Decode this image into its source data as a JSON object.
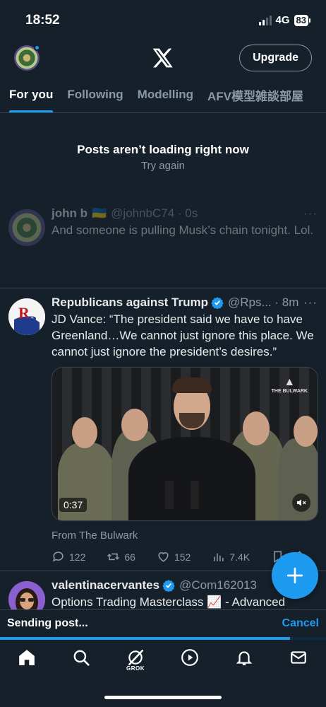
{
  "status_bar": {
    "time": "18:52",
    "network": "4G",
    "battery": "83"
  },
  "header": {
    "upgrade_label": "Upgrade"
  },
  "tabs": [
    {
      "label": "For you",
      "active": true
    },
    {
      "label": "Following",
      "active": false
    },
    {
      "label": "Modelling",
      "active": false
    },
    {
      "label": "AFV模型雑談部屋",
      "active": false
    }
  ],
  "notice": {
    "title": "Posts aren’t loading right now",
    "retry": "Try again"
  },
  "posts": [
    {
      "name": "john b",
      "flag": "🇺🇦",
      "handle": "@johnbC74 · 0s",
      "more": "···",
      "text": "And someone is pulling Musk’s chain tonight. Lol."
    },
    {
      "name": "Republicans against Trump",
      "handle": "@Rps... · 8m",
      "more": "···",
      "avatar_text": "RB",
      "text": "JD Vance: “The president said we have to have Greenland…We cannot just ignore this place. We cannot just ignore the president’s desires.”",
      "video_duration": "0:37",
      "video_watermark": "THE BULWARK",
      "source": "From The Bulwark",
      "replies": "122",
      "reposts": "66",
      "likes": "152",
      "views": "7.4K"
    },
    {
      "name": "valentinacervantes",
      "handle": "@Com162013",
      "text": "Options Trading Masterclass 📈 - Advanced"
    }
  ],
  "sending": {
    "label": "Sending post...",
    "cancel_label": "Cancel",
    "progress": 0.89
  },
  "bottom_nav": {
    "grok_label": "GROK"
  },
  "colors": {
    "background": "#15202b",
    "accent": "#1d9bf0",
    "muted": "#8b98a5",
    "divider": "#38444d"
  }
}
